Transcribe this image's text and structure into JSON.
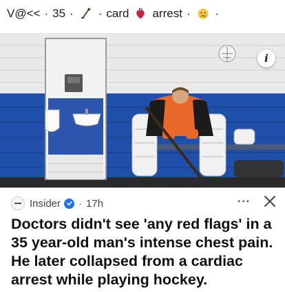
{
  "header": {
    "prefix": "V@<<",
    "num": "35",
    "word1": "card",
    "word2": "arrest",
    "separator": "·",
    "icons": [
      "hockey-stick-icon",
      "anatomical-heart-icon",
      "sad-face-icon"
    ]
  },
  "article": {
    "source": "Insider",
    "age": "17h",
    "more": "···",
    "headline": "Doctors didn't see 'any red flags' in a 35 year-old man's intense chest pain. He later collapsed from a cardiac arrest while playing hockey.",
    "info_button": "i"
  },
  "colors": {
    "wall_blue": "#1f4fa8",
    "wall_white": "#ececec",
    "jersey_orange": "#e8672a",
    "verified_blue": "#1a73e8"
  }
}
